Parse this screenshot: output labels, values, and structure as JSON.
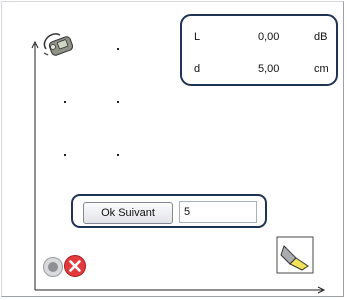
{
  "readout": {
    "rows": [
      {
        "name": "L",
        "value": "0,00",
        "unit": "dB"
      },
      {
        "name": "d",
        "value": "5,00",
        "unit": "cm"
      }
    ]
  },
  "controls": {
    "ok_button_label": "Ok Suivant",
    "input_value": "5"
  },
  "icons": {
    "source": "sound-meter-icon",
    "stop": "stop-icon",
    "cancel": "cancel-icon",
    "eraser": "eraser-icon"
  },
  "colors": {
    "box_border": "#1f3354",
    "cancel_red": "#d8262b"
  }
}
